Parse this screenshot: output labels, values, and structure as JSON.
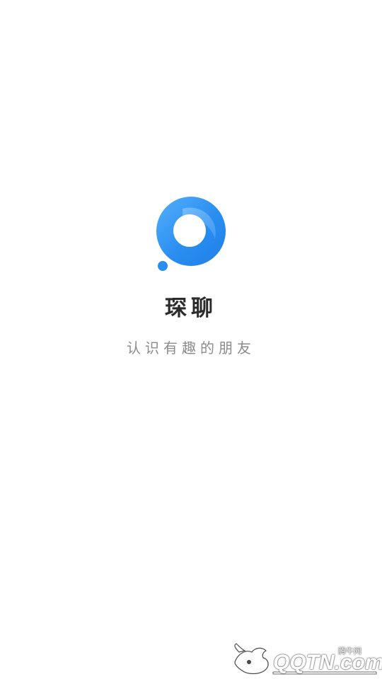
{
  "app": {
    "name": "琛聊",
    "slogan": "认识有趣的朋友"
  },
  "icons": {
    "logo": "chat-bubble-ring-logo"
  },
  "colors": {
    "brand_blue": "#2a8ef0",
    "brand_blue_light": "#54b0fb",
    "title_text": "#2b2b2b",
    "slogan_text": "#8c8c8c",
    "background": "#ffffff"
  },
  "watermark": {
    "site_name": "腾牛网",
    "brand_text": "QQTN.com"
  }
}
